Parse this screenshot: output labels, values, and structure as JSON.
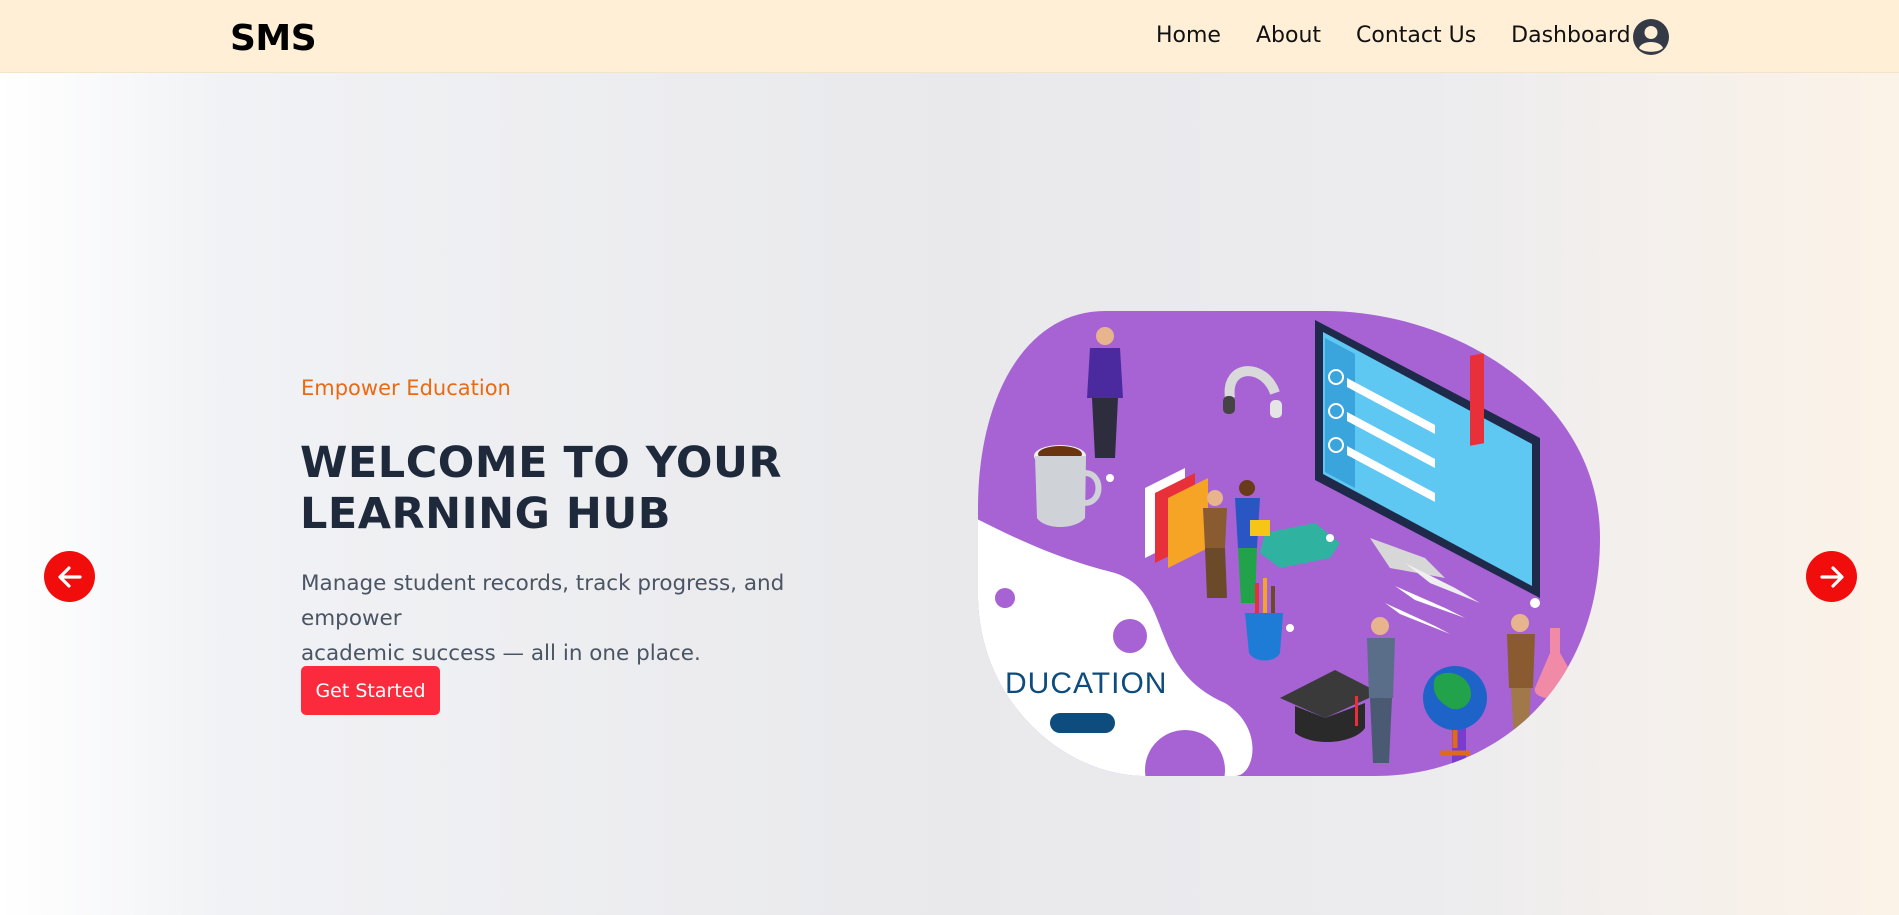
{
  "navbar": {
    "brand": "SMS",
    "links": [
      "Home",
      "About",
      "Contact Us",
      "Dashboard"
    ],
    "profile_icon": "user-circle-icon"
  },
  "hero": {
    "eyebrow": "Empower Education",
    "title_line1": "WELCOME TO YOUR",
    "title_line2": "LEARNING HUB",
    "description_line1": "Manage student records, track progress, and empower",
    "description_line2": "academic success — all in one place.",
    "cta_label": "Get Started",
    "illustration_text": "DUCATION"
  },
  "carousel": {
    "prev_icon": "arrow-left-icon",
    "next_icon": "arrow-right-icon"
  },
  "colors": {
    "navbar_bg": "#feefd6",
    "accent_orange": "#ea6a12",
    "cta_red": "#fb2a3c",
    "arrow_red": "#f20d0d",
    "illustration_purple": "#a763d4",
    "title_color": "#1e2a3b"
  }
}
